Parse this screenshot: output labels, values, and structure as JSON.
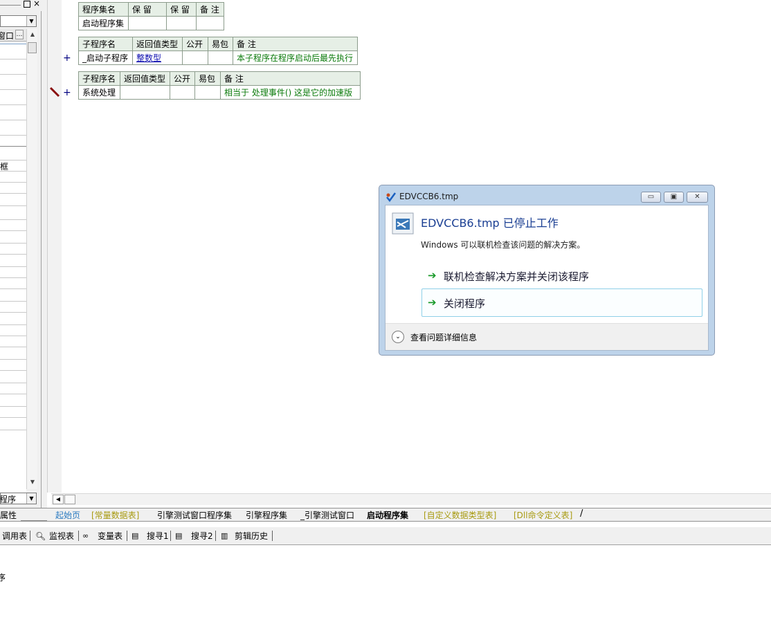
{
  "left_panel": {
    "combo_top": "",
    "header_label": "窗口",
    "header_more": "…",
    "row_label": "框",
    "bottom_combo": "程序",
    "tab_label": "属性"
  },
  "editor": {
    "set_table": {
      "headers": [
        "程序集名",
        "保 留",
        "保 留",
        "备 注"
      ],
      "row": [
        "启动程序集",
        "",
        "",
        ""
      ]
    },
    "sub1": {
      "headers": [
        "子程序名",
        "返回值类型",
        "公开",
        "易包",
        "备 注"
      ],
      "name": "_启动子程序",
      "return_type": "整数型",
      "public": "",
      "easypack": "",
      "note": "本子程序在程序启动后最先执行"
    },
    "sub2": {
      "headers": [
        "子程序名",
        "返回值类型",
        "公开",
        "易包",
        "备 注"
      ],
      "name": "系统处理",
      "return_type": "",
      "public": "",
      "easypack": "",
      "note": "相当于 处理事件() 这是它的加速版"
    },
    "plus": "+"
  },
  "tabs": [
    {
      "label": "起始页",
      "color": "#2a7ac0"
    },
    {
      "label": "[常量数据表]",
      "color": "#a89a10"
    },
    {
      "label": "引擎测试窗口程序集",
      "color": "#000000"
    },
    {
      "label": "引擎程序集",
      "color": "#000000"
    },
    {
      "label": "_引擎测试窗口",
      "color": "#000000"
    },
    {
      "label": "启动程序集",
      "color": "#000000"
    },
    {
      "label": "[自定义数据类型表]",
      "color": "#a89a10"
    },
    {
      "label": "[Dll命令定义表]",
      "color": "#a89a10"
    }
  ],
  "toolbar": [
    {
      "label": "调用表",
      "icon": "call-table-icon"
    },
    {
      "label": "监视表",
      "icon": "magnifier-icon"
    },
    {
      "label": "变量表",
      "icon": "glasses-icon"
    },
    {
      "label": "搜寻1",
      "icon": "search-doc-icon"
    },
    {
      "label": "搜寻2",
      "icon": "search-doc-icon"
    },
    {
      "label": "剪辑历史",
      "icon": "clipboard-icon"
    }
  ],
  "output": {
    "text": "序"
  },
  "dialog": {
    "title": "EDVCCB6.tmp",
    "heading": "EDVCCB6.tmp 已停止工作",
    "description": "Windows 可以联机检查该问题的解决方案。",
    "option1": "联机检查解决方案并关闭该程序",
    "option2": "关闭程序",
    "details": "查看问题详细信息",
    "heading_color": "#1b3f93",
    "arrow_color": "#1a9a2a"
  }
}
